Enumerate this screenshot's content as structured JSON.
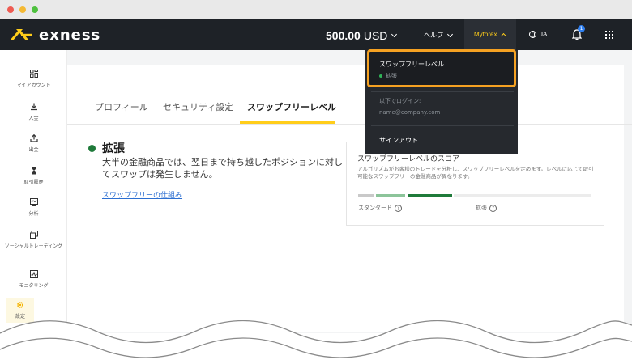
{
  "header": {
    "brand": "exness",
    "balance": "500.00",
    "currency": "USD",
    "help_label": "ヘルプ",
    "account_label": "Myforex",
    "language": "JA",
    "notification_count": "1"
  },
  "sidebar": {
    "items": [
      {
        "label": "マイアカウント",
        "icon": "dashboard-icon"
      },
      {
        "label": "入金",
        "icon": "deposit-icon"
      },
      {
        "label": "出金",
        "icon": "withdraw-icon"
      },
      {
        "label": "取引履歴",
        "icon": "history-icon"
      },
      {
        "label": "分析",
        "icon": "analytics-icon"
      },
      {
        "label": "ソーシャルトレーディング",
        "icon": "social-trading-icon"
      },
      {
        "label": "モニタリング",
        "icon": "monitoring-icon"
      },
      {
        "label": "設定",
        "icon": "settings-icon"
      }
    ]
  },
  "tabs": {
    "profile": "プロフィール",
    "security": "セキュリティ設定",
    "swap_free": "スワップフリーレベル"
  },
  "status": {
    "title": "拡張",
    "description": "大半の金融商品では、翌日まで持ち越したポジションに対してスワップは発生しません。",
    "link": "スワップフリーの仕組み"
  },
  "score": {
    "title": "スワップフリーレベルのスコア",
    "description": "アルゴリズムがお客様のトレードを分析し、スワップフリーレベルを定めます。レベルに応じて取引可能なスワップフリーの金融商品が異なります。",
    "standard_label": "スタンダード",
    "extended_label": "拡張",
    "accent_color": "#1f7a3a"
  },
  "dropdown": {
    "title": "スワップフリーレベル",
    "status": "拡張",
    "login_label": "以下でログイン:",
    "email": "name@company.com",
    "signout": "サインアウト",
    "highlight_color": "#f5a122"
  }
}
